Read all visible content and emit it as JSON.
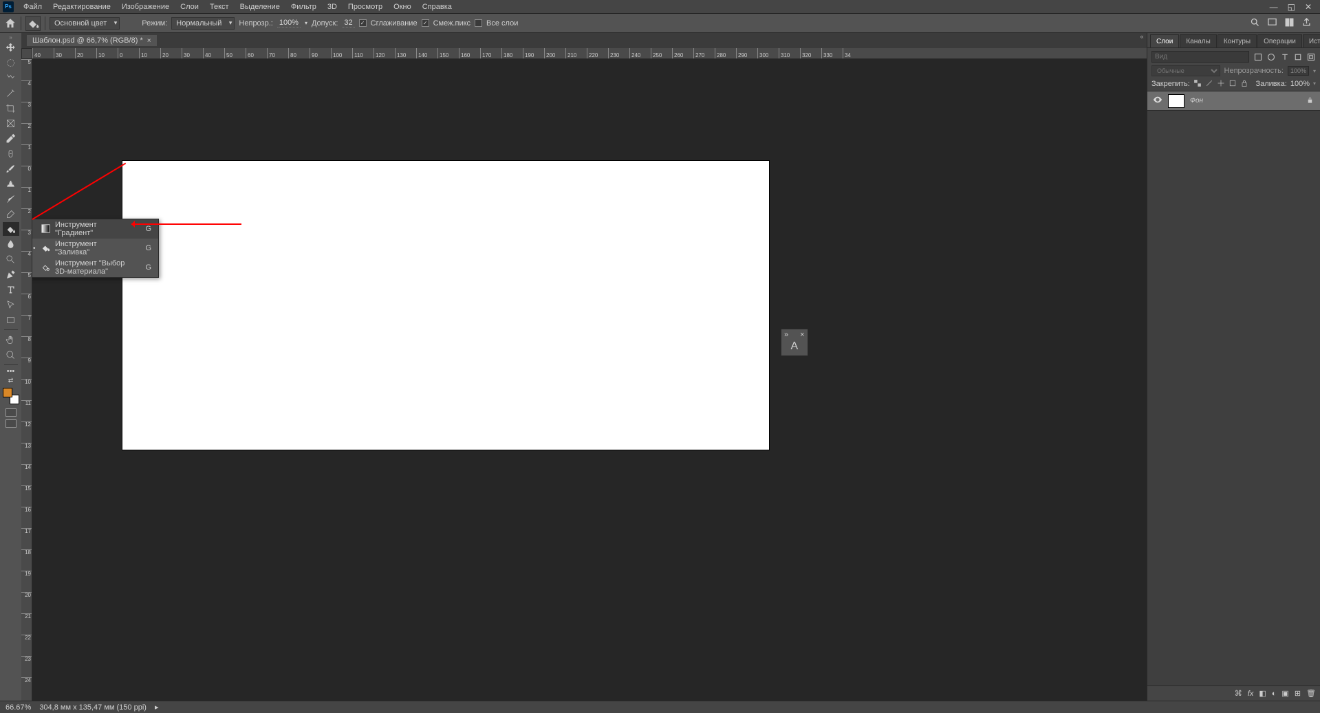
{
  "menu": {
    "items": [
      "Файл",
      "Редактирование",
      "Изображение",
      "Слои",
      "Текст",
      "Выделение",
      "Фильтр",
      "3D",
      "Просмотр",
      "Окно",
      "Справка"
    ]
  },
  "doc_tab": "Шаблон.psd @ 66,7% (RGB/8) *",
  "options": {
    "dd_main": "Основной цвет",
    "mode_label": "Режим:",
    "mode_value": "Нормальный",
    "opacity_label": "Непрозр.:",
    "opacity_value": "100%",
    "tolerance_label": "Допуск:",
    "tolerance_value": "32",
    "antialias": "Сглаживание",
    "contiguous": "Смеж.пикс",
    "all_layers": "Все слои"
  },
  "ruler_h": [
    "40",
    "30",
    "20",
    "10",
    "0",
    "10",
    "20",
    "30",
    "40",
    "50",
    "60",
    "70",
    "80",
    "90",
    "100",
    "110",
    "120",
    "130",
    "140",
    "150",
    "160",
    "170",
    "180",
    "190",
    "200",
    "210",
    "220",
    "230",
    "240",
    "250",
    "260",
    "270",
    "280",
    "290",
    "300",
    "310",
    "320",
    "330",
    "34"
  ],
  "ruler_v": [
    "5",
    "4",
    "3",
    "2",
    "1",
    "0",
    "1",
    "2",
    "3",
    "4",
    "5",
    "6",
    "7",
    "8",
    "9",
    "10",
    "11",
    "12",
    "13",
    "14",
    "15",
    "16",
    "17",
    "18",
    "19",
    "20",
    "21",
    "22",
    "23",
    "24"
  ],
  "flyout": {
    "items": [
      {
        "name": "Инструмент \"Градиент\"",
        "shortcut": "G"
      },
      {
        "name": "Инструмент \"Заливка\"",
        "shortcut": "G"
      },
      {
        "name": "Инструмент \"Выбор 3D-материала\"",
        "shortcut": "G"
      }
    ]
  },
  "panels": {
    "tabs": [
      "Слои",
      "Каналы",
      "Контуры",
      "Операции",
      "История"
    ],
    "search_placeholder": "Вид",
    "blend_mode": "Обычные",
    "opacity_label": "Непрозрачность:",
    "opacity_value": "100%",
    "lock_label": "Закрепить:",
    "fill_label": "Заливка:",
    "fill_value": "100%",
    "layer_name": "Фон"
  },
  "char_panel_letter": "A",
  "status": {
    "zoom": "66.67%",
    "doc": "304,8 мм x 135,47 мм (150 ppi)"
  },
  "colors": {
    "fg": "#d98828"
  }
}
